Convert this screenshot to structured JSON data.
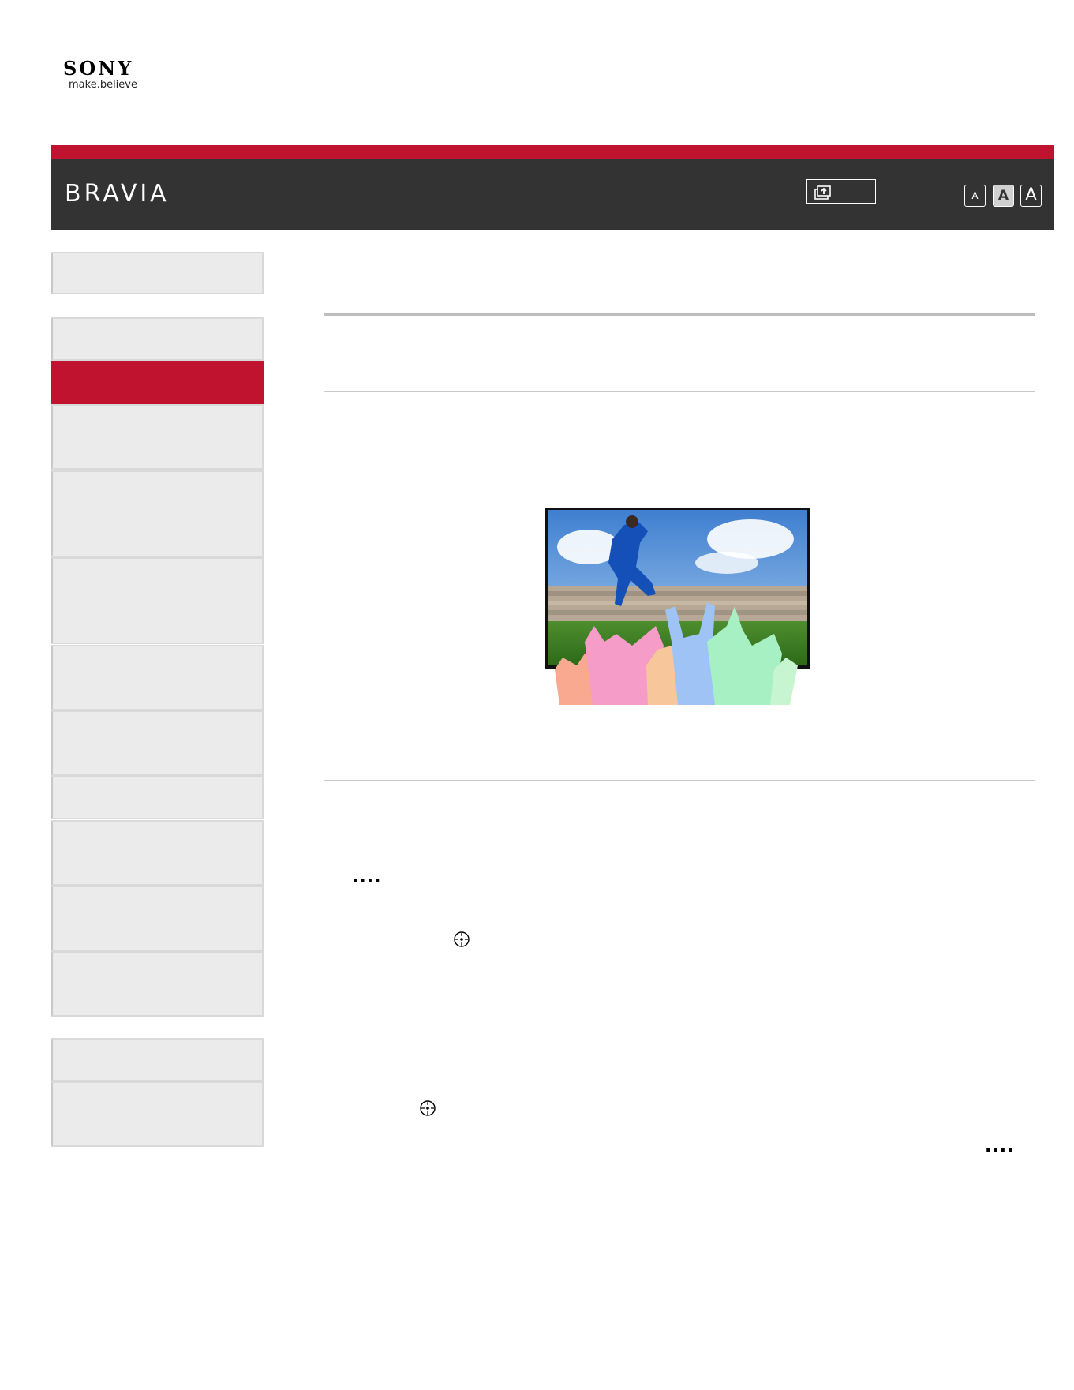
{
  "header": {
    "logo_brand": "SONY",
    "logo_tagline": "make.believe",
    "product_title": "BRAVIA",
    "upload_icon": "upload-icon",
    "font_sizes": [
      "A",
      "A",
      "A"
    ]
  },
  "colors": {
    "accent": "#c0132f",
    "header_bg": "#333333",
    "nav_bg": "#ebebeb"
  },
  "sidebar": {
    "items": [
      {
        "label": ""
      },
      {
        "label": ""
      },
      {
        "label": ""
      },
      {
        "label": ""
      },
      {
        "label": ""
      },
      {
        "label": ""
      },
      {
        "label": ""
      },
      {
        "label": ""
      },
      {
        "label": ""
      },
      {
        "label": ""
      },
      {
        "label": ""
      },
      {
        "label": ""
      },
      {
        "label": ""
      },
      {
        "label": ""
      }
    ],
    "active_index": 2
  },
  "content": {
    "more_indicator_1": "....",
    "more_indicator_2": "....",
    "enter_icon": "enter-button-icon"
  }
}
